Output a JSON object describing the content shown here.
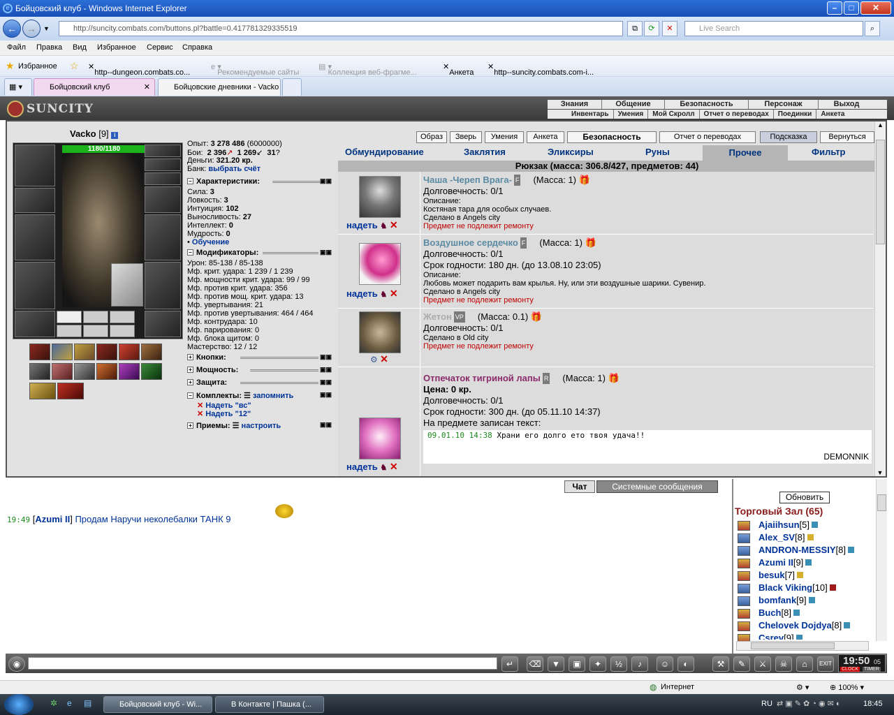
{
  "window": {
    "title": "Бойцовский клуб - Windows Internet Explorer"
  },
  "address": {
    "url": "http://suncity.combats.com/buttons.pl?battle=0.417781329335519",
    "search_placeholder": "Live Search"
  },
  "menu": [
    "Файл",
    "Правка",
    "Вид",
    "Избранное",
    "Сервис",
    "Справка"
  ],
  "favorites": {
    "label": "Избранное",
    "items": [
      "http--dungeon.combats.co...",
      "Рекомендуемые сайты",
      "Коллекция веб-фрагме...",
      "Анкета",
      "http--suncity.combats.com-i..."
    ]
  },
  "tabs": [
    "Бойцовский клуб",
    "Бойцовские дневники - Vacko"
  ],
  "game": {
    "logo": "SUNCITY",
    "topnav1": [
      "Знания",
      "Общение",
      "Безопасность",
      "Персонаж",
      "Выход"
    ],
    "topnav2": [
      "Инвентарь",
      "Умения",
      "Мой Скролл",
      "Отчет о переводах",
      "Поединки",
      "Анкета"
    ]
  },
  "character": {
    "name": "Vacko",
    "level": "[9]",
    "hp": "1180/1180",
    "exp_label": "Опыт:",
    "exp": "3 278 486",
    "exp_next": "(6000000)",
    "fights_label": "Бои:",
    "wins": "2 396",
    "losses": "1 269",
    "draws": "31",
    "money_label": "Деньги:",
    "money": "321.20 кр.",
    "bank_label": "Банк:",
    "bank": "выбрать счёт"
  },
  "sections": {
    "characteristics": "Характеристики:",
    "modifiers": "Модификаторы:",
    "buttons": "Кнопки:",
    "powers": "Мощность:",
    "protection": "Защита:",
    "sets": "Комплекты:",
    "sets_remember": "запомнить",
    "techniques": "Приемы:",
    "techniques_setup": "настроить",
    "training": "Обучение"
  },
  "stats": [
    [
      "Сила:",
      "3"
    ],
    [
      "Ловкость:",
      "3"
    ],
    [
      "Интуиция:",
      "102"
    ],
    [
      "Выносливость:",
      "27"
    ],
    [
      "Интеллект:",
      "0"
    ],
    [
      "Мудрость:",
      "0"
    ]
  ],
  "modifiers": [
    "Урон: 85-138 / 85-138",
    "Мф. крит. удара: 1 239 / 1 239",
    "Мф. мощности крит. удара: 99 / 99",
    "Мф. против крит. удара: 356",
    "Мф. против мощ. крит. удара: 13",
    "Мф. увертывания: 21",
    "Мф. против увертывания: 464 / 464",
    "Мф. контрудара: 10",
    "Мф. парирования: 0",
    "Мф. блока щитом: 0",
    "Мастерство: 12 / 12"
  ],
  "sets": [
    "Надеть \"вс\"",
    "Надеть \"12\""
  ],
  "topbuttons": [
    "Образ",
    "Зверь",
    "Умения",
    "Анкета",
    "Безопасность",
    "Отчет о переводах",
    "Подсказка",
    "Вернуться"
  ],
  "invtabs": [
    "Обмундирование",
    "Заклятия",
    "Эликсиры",
    "Руны",
    "Прочее",
    "Фильтр"
  ],
  "bag": "Рюкзак (масса: 306.8/427, предметов: 44)",
  "put_on": "надеть",
  "items": [
    {
      "name": "Чаша -Череп Врага-",
      "badge": "F",
      "mass": "(Масса: 1)",
      "lines": [
        "Долговечность: 0/1"
      ],
      "desc_label": "Описание:",
      "desc": "Костяная тара для особых случаев.",
      "made": "Сделано в Angels city",
      "norepair": "Предмет не подлежит ремонту"
    },
    {
      "name": "Воздушное сердечко",
      "badge": "F",
      "mass": "(Масса: 1)",
      "lines": [
        "Долговечность: 0/1",
        "Срок годности: 180 дн. (до 13.08.10 23:05)"
      ],
      "desc_label": "Описание:",
      "desc": "Любовь может подарить вам крылья. Ну, или эти воздушные шарики. Сувенир.",
      "made": "Сделано в Angels city",
      "norepair": "Предмет не подлежит ремонту"
    },
    {
      "name": "Жетон",
      "badge": "VP",
      "mass": "(Масса: 0.1)",
      "lines": [
        "Долговечность: 0/1"
      ],
      "made": "Сделано в Old city",
      "norepair": "Предмет не подлежит ремонту"
    },
    {
      "name": "Отпечаток тигриной лапы",
      "badge": "R",
      "mass": "(Масса: 1)",
      "price": "Цена: 0 кр.",
      "lines": [
        "Долговечность: 0/1",
        "Срок годности: 300 дн. (до 05.11.10 14:37)",
        "На предмете записан текст:"
      ],
      "note_time": "09.01.10 14:38",
      "note_text": "Храни его долго ето твоя удача!!",
      "author": "DEMONNIK"
    }
  ],
  "chat": {
    "tab_chat": "Чат",
    "tab_system": "Системные сообщения",
    "messages": [
      {
        "time": "19:49",
        "author": "Azumi II",
        "text": "Продам Наручи неколебалки ТАНК 9"
      }
    ]
  },
  "online": {
    "refresh": "Обновить",
    "room": "Торговый Зал (65)",
    "users": [
      {
        "name": "Ajaiihsun",
        "lv": "[5]"
      },
      {
        "name": "Alex_SV",
        "lv": "[8]"
      },
      {
        "name": "ANDRON-MESSIY",
        "lv": "[8]"
      },
      {
        "name": "Azumi II",
        "lv": "[9]"
      },
      {
        "name": "besuk",
        "lv": "[7]"
      },
      {
        "name": "Black Viking",
        "lv": "[10]"
      },
      {
        "name": "bomfank",
        "lv": "[9]"
      },
      {
        "name": "Buch",
        "lv": "[8]"
      },
      {
        "name": "Chelovek Dojdya",
        "lv": "[8]"
      },
      {
        "name": "Csrev",
        "lv": "[9]"
      }
    ]
  },
  "clock": {
    "time": "19:50",
    "sec": "05",
    "label1": "CLOCK",
    "label2": "TIMER"
  },
  "status": {
    "zone": "Интернет",
    "zoom": "100%"
  },
  "taskbar": {
    "tasks": [
      "Бойцовский клуб - Wi...",
      "В Контакте | Пашка (..."
    ],
    "lang": "RU",
    "time": "18:45"
  }
}
